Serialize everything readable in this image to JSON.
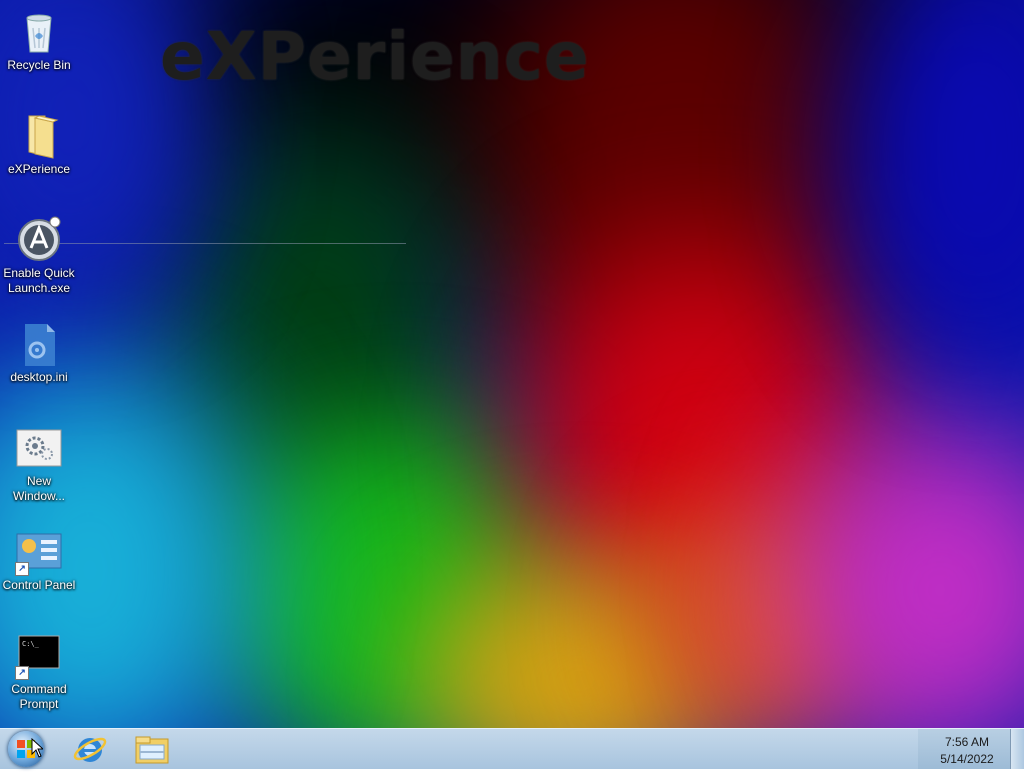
{
  "wallpaper": {
    "watermark": "eXPerience"
  },
  "desktop_icons": [
    {
      "label": "Recycle Bin"
    },
    {
      "label": "eXPerience"
    },
    {
      "label": "Enable Quick Launch.exe"
    },
    {
      "label": "desktop.ini"
    },
    {
      "label": "New Window..."
    },
    {
      "label": "Control Panel"
    },
    {
      "label": "Command Prompt"
    }
  ],
  "taskbar": {
    "pinned": [
      "internet-explorer-icon",
      "windows-explorer-icon"
    ],
    "clock": {
      "time": "7:56 AM",
      "date": "5/14/2022"
    }
  }
}
